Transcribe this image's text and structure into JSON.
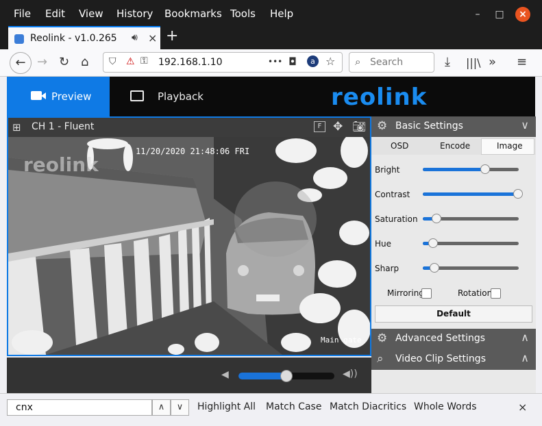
{
  "menubar": {
    "items": [
      "File",
      "Edit",
      "View",
      "History",
      "Bookmarks",
      "Tools",
      "Help"
    ],
    "minimize": "–",
    "maximize": "□",
    "close": "×"
  },
  "tab": {
    "title": "Reolink - v1.0.265",
    "close": "×",
    "new_tab": "+"
  },
  "navbar": {
    "url": "192.168.1.10",
    "search_placeholder": "Search",
    "more": "•••"
  },
  "app": {
    "logo": "reolink",
    "tabs": [
      "Preview",
      "Playback"
    ],
    "active_tab": "Preview"
  },
  "video": {
    "channel": "CH 1 - Fluent",
    "timestamp": "11/20/2020 21:48:06 FRI",
    "camera_name": "Main gate",
    "watermark": "reolink",
    "volume": 0.5
  },
  "settings": {
    "basic_title": "Basic Settings",
    "subtabs": [
      "OSD",
      "Encode",
      "Image"
    ],
    "active_subtab": "Image",
    "sliders": [
      {
        "label": "Bright",
        "value": 0.65
      },
      {
        "label": "Contrast",
        "value": 0.99
      },
      {
        "label": "Saturation",
        "value": 0.14
      },
      {
        "label": "Hue",
        "value": 0.11
      },
      {
        "label": "Sharp",
        "value": 0.12
      }
    ],
    "mirroring_label": "Mirroring",
    "mirroring_checked": false,
    "rotation_label": "Rotation",
    "rotation_checked": false,
    "default_button": "Default",
    "advanced_title": "Advanced Settings",
    "clip_title": "Video Clip Settings"
  },
  "findbar": {
    "value": "cnx",
    "options": [
      "Highlight All",
      "Match Case",
      "Match Diacritics",
      "Whole Words"
    ],
    "close": "×"
  },
  "colors": {
    "accent": "#0f7ae5",
    "close_button": "#e95420",
    "logo": "#1a8cf0"
  }
}
